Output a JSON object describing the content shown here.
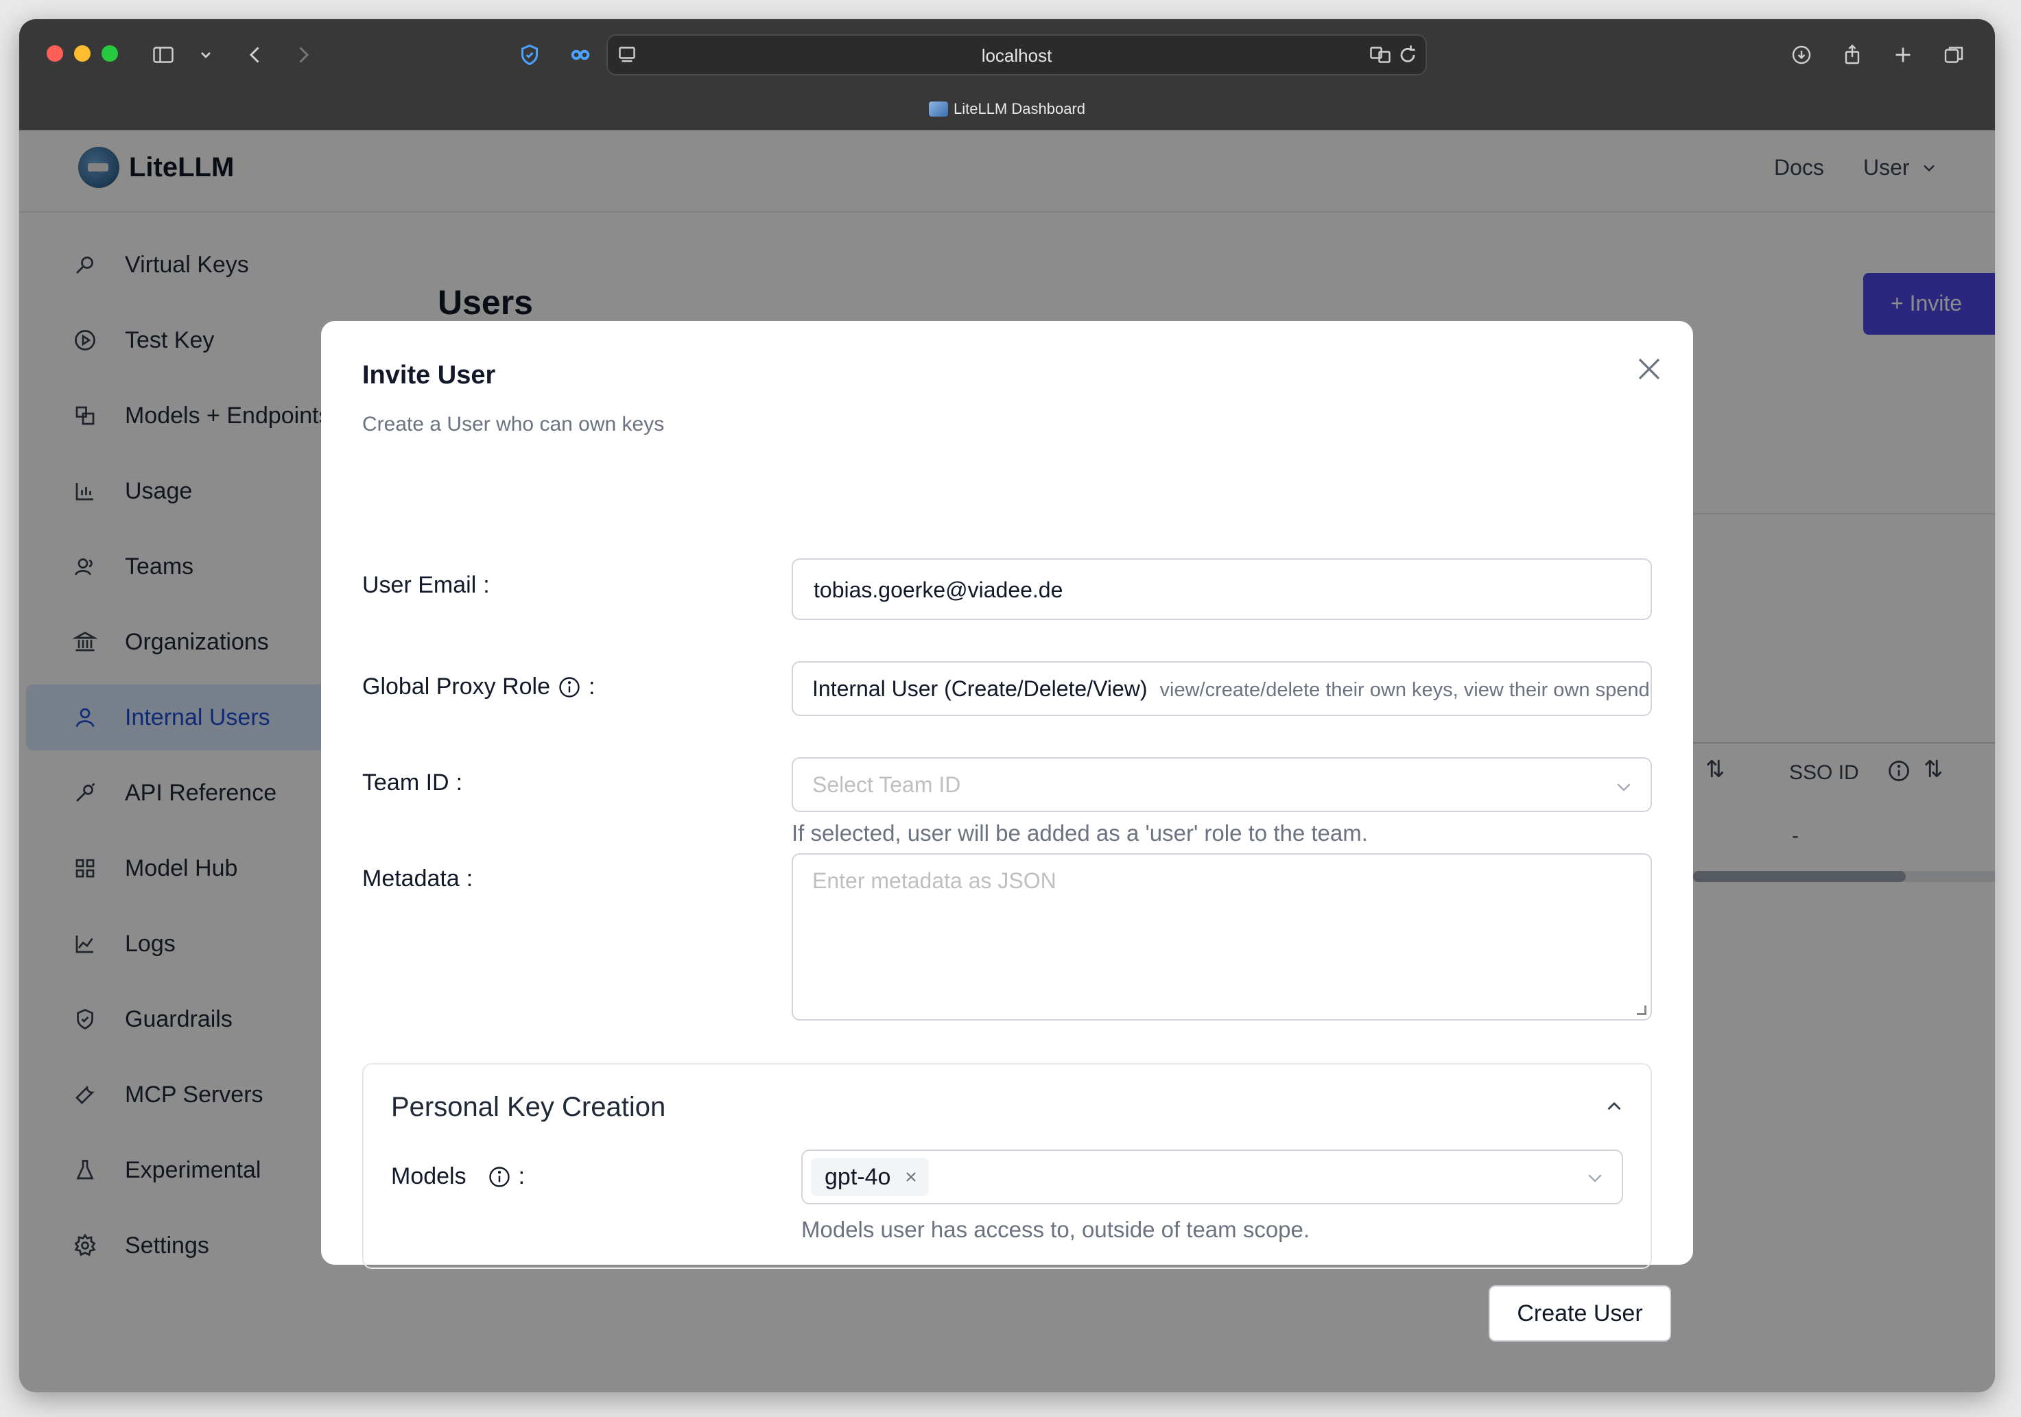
{
  "browser": {
    "url": "localhost",
    "tab_title": "LiteLLM Dashboard"
  },
  "header": {
    "brand": "LiteLLM",
    "docs_link": "Docs",
    "user_menu": "User"
  },
  "sidebar": {
    "items": [
      {
        "label": "Virtual Keys",
        "icon": "search-key-icon"
      },
      {
        "label": "Test Key",
        "icon": "play-circle-icon"
      },
      {
        "label": "Models + Endpoints",
        "icon": "blocks-icon"
      },
      {
        "label": "Usage",
        "icon": "bar-chart-icon"
      },
      {
        "label": "Teams",
        "icon": "team-icon"
      },
      {
        "label": "Organizations",
        "icon": "bank-icon"
      },
      {
        "label": "Internal Users",
        "icon": "user-icon",
        "active": true
      },
      {
        "label": "API Reference",
        "icon": "api-icon"
      },
      {
        "label": "Model Hub",
        "icon": "grid-icon"
      },
      {
        "label": "Logs",
        "icon": "line-chart-icon"
      },
      {
        "label": "Guardrails",
        "icon": "shield-icon"
      },
      {
        "label": "MCP Servers",
        "icon": "tool-icon"
      },
      {
        "label": "Experimental",
        "icon": "flask-icon"
      },
      {
        "label": "Settings",
        "icon": "gear-icon"
      }
    ]
  },
  "background": {
    "page_title": "Users",
    "invite_button": "+ Invite",
    "column_sso": "SSO ID",
    "cell_value": "-"
  },
  "modal": {
    "title": "Invite User",
    "subtitle": "Create a User who can own keys",
    "email_label": "User Email",
    "email_value": "tobias.goerke@viadee.de",
    "role_label": "Global Proxy Role",
    "role_value": "Internal User (Create/Delete/View)",
    "role_desc": "view/create/delete their own keys, view their own spend",
    "team_label": "Team ID",
    "team_placeholder": "Select Team ID",
    "team_help": "If selected, user will be added as a 'user' role to the team.",
    "metadata_label": "Metadata",
    "metadata_placeholder": "Enter metadata as JSON",
    "personal_key_title": "Personal Key Creation",
    "models_label": "Models",
    "models_selected": [
      "gpt-4o"
    ],
    "models_help": "Models user has access to, outside of team scope.",
    "create_button": "Create User"
  },
  "colors": {
    "accent": "#4f46e5",
    "active_nav_bg": "#dbeafe",
    "active_nav_text": "#1d4ed8"
  }
}
